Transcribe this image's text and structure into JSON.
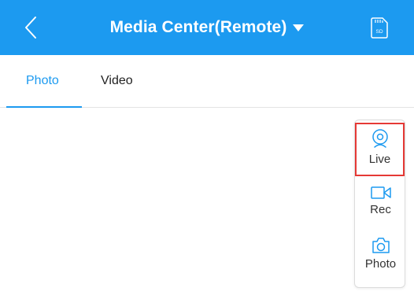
{
  "header": {
    "title": "Media Center(Remote)",
    "sd_label": "SD",
    "bg_color": "#1c9af0"
  },
  "tabs": [
    {
      "label": "Photo",
      "active": true
    },
    {
      "label": "Video",
      "active": false
    }
  ],
  "side_panel": {
    "items": [
      {
        "label": "Live",
        "icon": "webcam-icon",
        "highlighted": true
      },
      {
        "label": "Rec",
        "icon": "video-camera-icon",
        "highlighted": false
      },
      {
        "label": "Photo",
        "icon": "camera-icon",
        "highlighted": false
      }
    ],
    "highlight_color": "#e53935"
  },
  "colors": {
    "accent": "#1c9af0",
    "text": "#222222"
  }
}
